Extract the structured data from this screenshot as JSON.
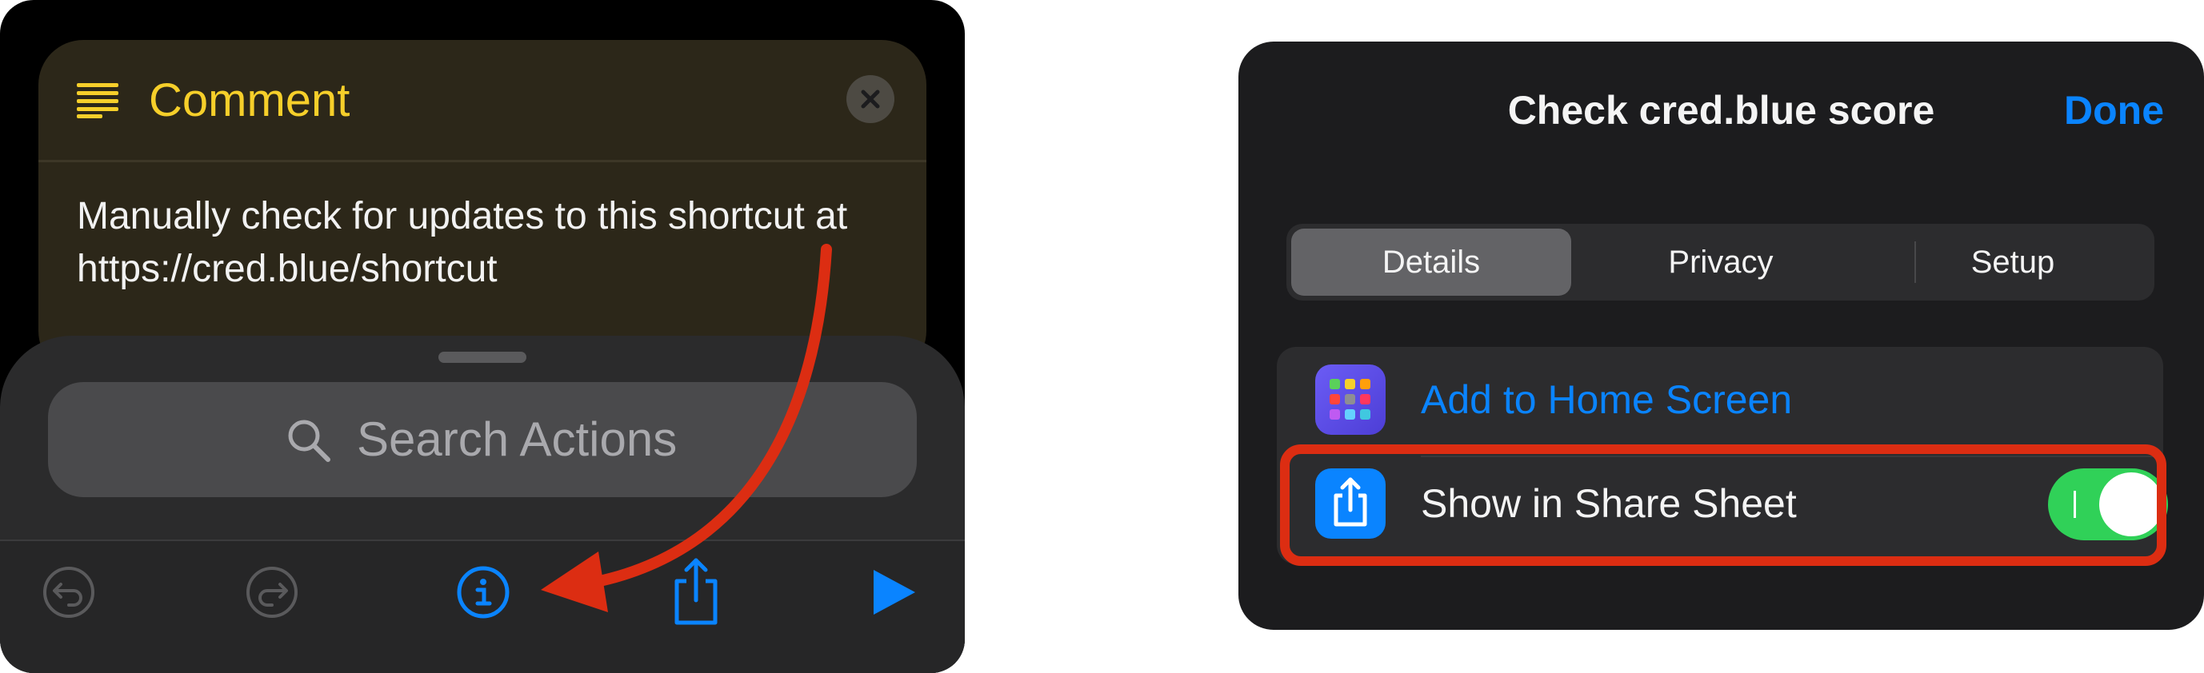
{
  "left": {
    "comment": {
      "title": "Comment",
      "text": "Manually check for updates to this shortcut at https://cred.blue/shortcut",
      "icon": "text-lines-icon",
      "close_icon": "close-icon"
    },
    "search": {
      "placeholder": "Search Actions",
      "icon": "search-icon"
    },
    "toolbar": {
      "items": [
        "undo-icon",
        "redo-icon",
        "info-icon",
        "share-icon",
        "play-icon"
      ],
      "accent": "#0a84ff",
      "disabled_color": "#5a5a5c"
    }
  },
  "right": {
    "title": "Check cred.blue score",
    "done_label": "Done",
    "tabs": [
      {
        "label": "Details",
        "selected": true
      },
      {
        "label": "Privacy",
        "selected": false
      },
      {
        "label": "Setup",
        "selected": false
      }
    ],
    "rows": [
      {
        "label": "Add to Home Screen",
        "icon": "home-screen-grid-icon"
      },
      {
        "label": "Show in Share Sheet",
        "icon": "share-icon",
        "toggle_on": true
      }
    ]
  },
  "colors": {
    "comment_yellow": "#f6cf2a",
    "link_blue": "#0a84ff",
    "toggle_green": "#30d158",
    "annotation_red": "#dc2d12"
  }
}
